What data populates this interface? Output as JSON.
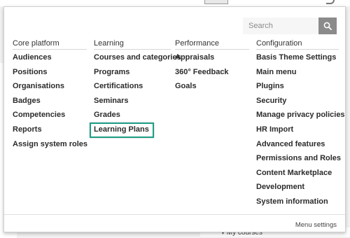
{
  "background": {
    "my_courses_label": "▾ My courses"
  },
  "search": {
    "placeholder": "Search",
    "icon": "search-icon"
  },
  "columns": [
    {
      "heading": "Core platform",
      "items": [
        "Audiences",
        "Positions",
        "Organisations",
        "Badges",
        "Competencies",
        "Reports",
        "Assign system roles"
      ]
    },
    {
      "heading": "Learning",
      "items": [
        "Courses and categories",
        "Programs",
        "Certifications",
        "Seminars",
        "Grades",
        "Learning Plans"
      ]
    },
    {
      "heading": "Performance",
      "items": [
        "Appraisals",
        "360° Feedback",
        "Goals"
      ]
    },
    {
      "heading": "Configuration",
      "items": [
        "Basis Theme Settings",
        "Main menu",
        "Plugins",
        "Security",
        "Manage privacy policies",
        "HR Import",
        "Advanced features",
        "Permissions and Roles",
        "Content Marketplace",
        "Development",
        "System information"
      ]
    }
  ],
  "highlighted_item": "Learning Plans",
  "highlight_color": "#1f9e86",
  "footer": {
    "menu_settings_label": "Menu settings"
  }
}
